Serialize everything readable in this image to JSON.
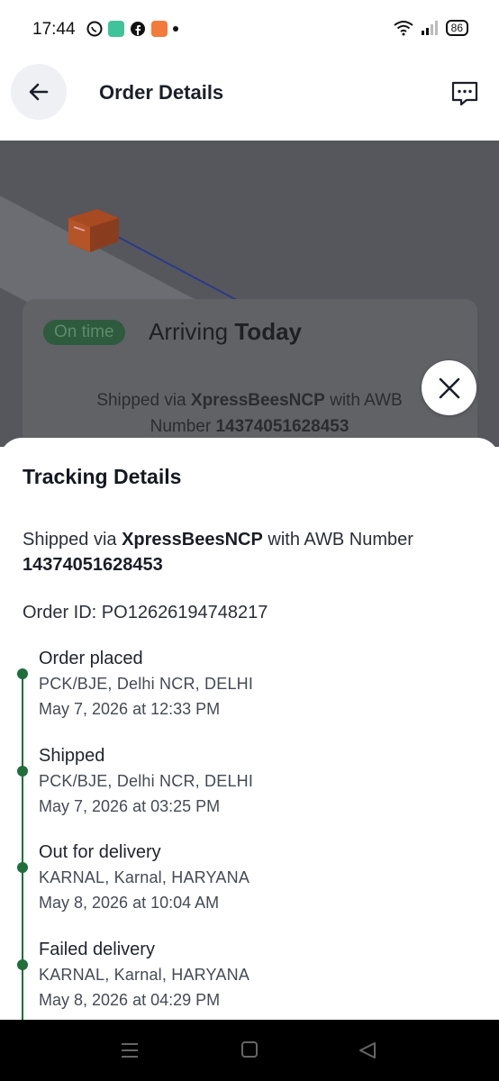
{
  "status_bar": {
    "time": "17:44",
    "battery": "86",
    "app_icons": [
      "whatsapp-icon",
      "chat-icon",
      "facebook-icon",
      "game-icon",
      "dot-icon"
    ]
  },
  "header": {
    "title": "Order Details"
  },
  "background_card": {
    "badge": "On time",
    "arriving_prefix": "Arriving ",
    "arriving_day": "Today",
    "shipped_prefix": "Shipped via ",
    "carrier": "XpressBeesNCP",
    "awb_text": " with AWB Number ",
    "awb_number": "14374051628453"
  },
  "sheet": {
    "title": "Tracking Details",
    "shipped_prefix": "Shipped via ",
    "carrier": "XpressBeesNCP",
    "awb_text": " with AWB Number",
    "awb_number": "14374051628453",
    "order_id_label": "Order ID: ",
    "order_id": "PO12626194748217"
  },
  "timeline": [
    {
      "status": "Order placed",
      "location": "PCK/BJE, Delhi NCR, DELHI",
      "time": "May 7, 2026 at 12:33 PM"
    },
    {
      "status": "Shipped",
      "location": "PCK/BJE, Delhi NCR, DELHI",
      "time": "May 7, 2026 at 03:25 PM"
    },
    {
      "status": "Out for delivery",
      "location": "KARNAL, Karnal, HARYANA",
      "time": "May 8, 2026 at 10:04 AM"
    },
    {
      "status": "Failed delivery",
      "location": "KARNAL, Karnal, HARYANA",
      "time": "May 8, 2026 at 04:29 PM"
    }
  ],
  "colors": {
    "accent_green": "#1f6e3c",
    "overlay": "#55575c"
  }
}
